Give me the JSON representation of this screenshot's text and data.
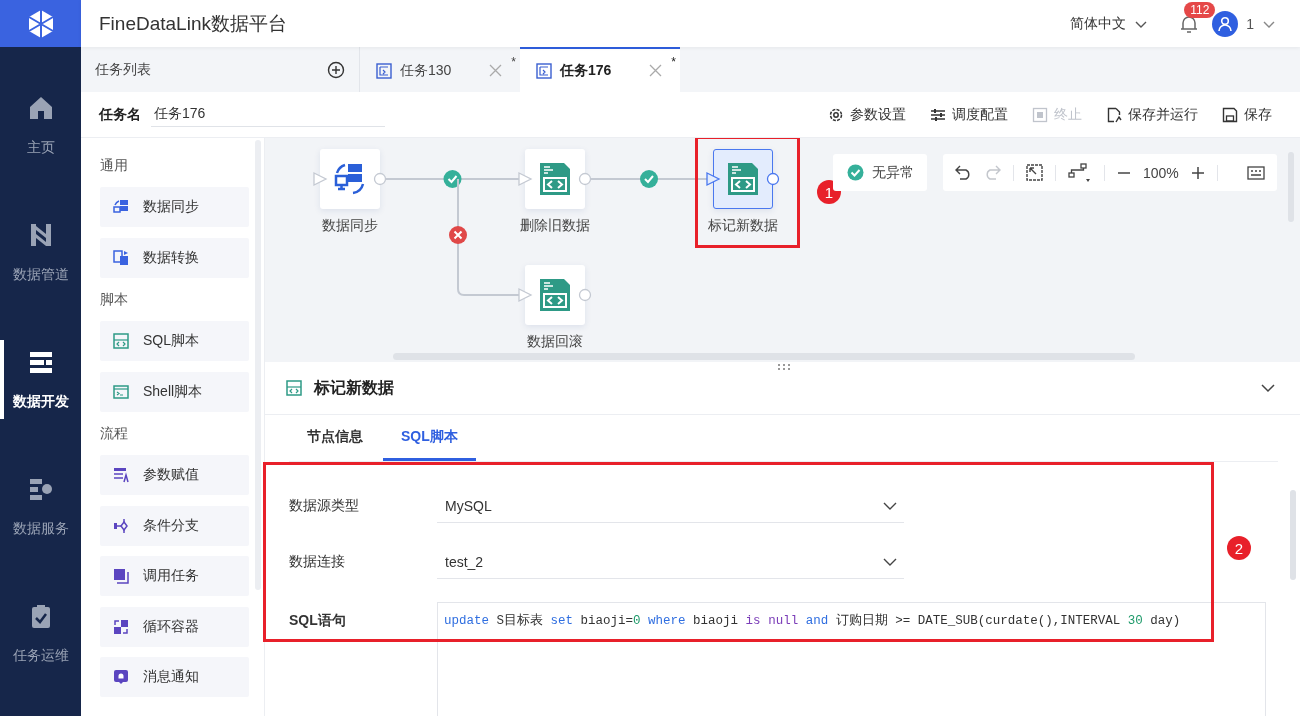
{
  "app": {
    "title": "FineDataLink数据平台"
  },
  "header": {
    "language": "简体中文",
    "notifications": "112",
    "user": "1"
  },
  "nav": [
    {
      "label": "主页",
      "kind": "home",
      "selected": false
    },
    {
      "label": "数据管道",
      "kind": "pipeline",
      "selected": false
    },
    {
      "label": "数据开发",
      "kind": "develop",
      "selected": true
    },
    {
      "label": "数据服务",
      "kind": "service",
      "selected": false
    },
    {
      "label": "任务运维",
      "kind": "ops",
      "selected": false
    }
  ],
  "tabs": {
    "list_label": "任务列表",
    "items": [
      {
        "label": "任务130",
        "selected": false,
        "mark": "*"
      },
      {
        "label": "任务176",
        "selected": true,
        "mark": "*"
      }
    ]
  },
  "task": {
    "name_label": "任务名",
    "name": "任务176"
  },
  "actions": [
    {
      "label": "参数设置",
      "kind": "settings",
      "disabled": false
    },
    {
      "label": "调度配置",
      "kind": "sliders",
      "disabled": false
    },
    {
      "label": "终止",
      "kind": "stop",
      "disabled": true
    },
    {
      "label": "保存并运行",
      "kind": "run",
      "disabled": false
    },
    {
      "label": "保存",
      "kind": "save",
      "disabled": false
    }
  ],
  "palette": [
    {
      "title": "通用",
      "items": [
        {
          "label": "数据同步",
          "kind": "sync"
        },
        {
          "label": "数据转换",
          "kind": "transform"
        }
      ]
    },
    {
      "title": "脚本",
      "items": [
        {
          "label": "SQL脚本",
          "kind": "sql"
        },
        {
          "label": "Shell脚本",
          "kind": "shell"
        }
      ]
    },
    {
      "title": "流程",
      "items": [
        {
          "label": "参数赋值",
          "kind": "param"
        },
        {
          "label": "条件分支",
          "kind": "branch"
        },
        {
          "label": "调用任务",
          "kind": "call"
        },
        {
          "label": "循环容器",
          "kind": "loop"
        },
        {
          "label": "消息通知",
          "kind": "notify"
        }
      ]
    }
  ],
  "canvas": {
    "status": "无异常",
    "zoom": "100%",
    "callout": "1",
    "nodes": [
      {
        "label": "数据同步",
        "kind": "sync",
        "selected": false,
        "highlighted": false
      },
      {
        "label": "删除旧数据",
        "kind": "sql",
        "selected": false,
        "highlighted": false
      },
      {
        "label": "标记新数据",
        "kind": "sql",
        "selected": true,
        "highlighted": true
      },
      {
        "label": "数据回滚",
        "kind": "sql",
        "selected": false,
        "highlighted": false
      }
    ],
    "edges": [
      {
        "passed": true
      },
      {
        "passed": true
      },
      {
        "passed": false
      }
    ]
  },
  "detail": {
    "title": "标记新数据",
    "callout": "2",
    "highlighted": true,
    "tabs": [
      {
        "label": "节点信息",
        "selected": false
      },
      {
        "label": "SQL脚本",
        "selected": true
      }
    ],
    "fields": [
      {
        "label": "数据源类型",
        "kind": "select",
        "value": "MySQL"
      },
      {
        "label": "数据连接",
        "kind": "select",
        "value": "test_2"
      },
      {
        "label": "SQL语句",
        "kind": "code",
        "tokens": [
          {
            "text": "update",
            "kind": "keyword"
          },
          {
            "text": " S目标表 ",
            "kind": "plain"
          },
          {
            "text": "set",
            "kind": "keyword"
          },
          {
            "text": " biaoji=",
            "kind": "plain"
          },
          {
            "text": "0 ",
            "kind": "number"
          },
          {
            "text": "where",
            "kind": "keyword"
          },
          {
            "text": " biaoji ",
            "kind": "plain"
          },
          {
            "text": "is ",
            "kind": "literal"
          },
          {
            "text": "null ",
            "kind": "literal"
          },
          {
            "text": "and",
            "kind": "keyword"
          },
          {
            "text": " 订购日期 >= DATE_SUB(curdate(),INTERVAL ",
            "kind": "plain"
          },
          {
            "text": "30",
            "kind": "number"
          },
          {
            "text": " day)",
            "kind": "plain"
          }
        ]
      }
    ]
  }
}
